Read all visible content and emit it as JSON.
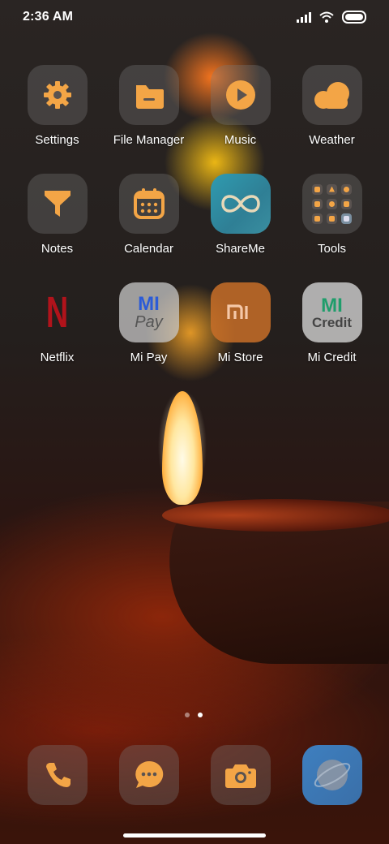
{
  "status_bar": {
    "time": "2:36 AM",
    "icons": [
      "signal-icon",
      "wifi-icon",
      "battery-icon"
    ]
  },
  "apps": [
    {
      "label": "Settings",
      "icon": "gear-icon"
    },
    {
      "label": "File Manager",
      "icon": "folder-icon"
    },
    {
      "label": "Music",
      "icon": "play-icon"
    },
    {
      "label": "Weather",
      "icon": "cloud-icon"
    },
    {
      "label": "Notes",
      "icon": "notes-icon"
    },
    {
      "label": "Calendar",
      "icon": "calendar-icon"
    },
    {
      "label": "ShareMe",
      "icon": "infinity-icon"
    },
    {
      "label": "Tools",
      "icon": "tools-icon"
    },
    {
      "label": "Netflix",
      "icon": "netflix-logo-icon",
      "logo_text": "N"
    },
    {
      "label": "Mi Pay",
      "icon": "mi-pay-icon",
      "logo_text": "MI",
      "logo_sub": "Pay"
    },
    {
      "label": "Mi Store",
      "icon": "mi-store-icon",
      "logo_text": "mi"
    },
    {
      "label": "Mi Credit",
      "icon": "mi-credit-icon",
      "logo_text": "MI",
      "logo_sub": "Credit"
    }
  ],
  "page_indicator": {
    "pages": 2,
    "current": 2
  },
  "dock": [
    {
      "icon": "phone-icon"
    },
    {
      "icon": "messages-icon"
    },
    {
      "icon": "camera-icon"
    },
    {
      "icon": "browser-icon"
    }
  ],
  "colors": {
    "accent": "#f3a546",
    "icon_bg": "rgba(120,120,120,0.35)",
    "netflix_red": "#b1131b",
    "mi_green": "#1f9d6b",
    "mi_blue": "#2b5bd7"
  }
}
